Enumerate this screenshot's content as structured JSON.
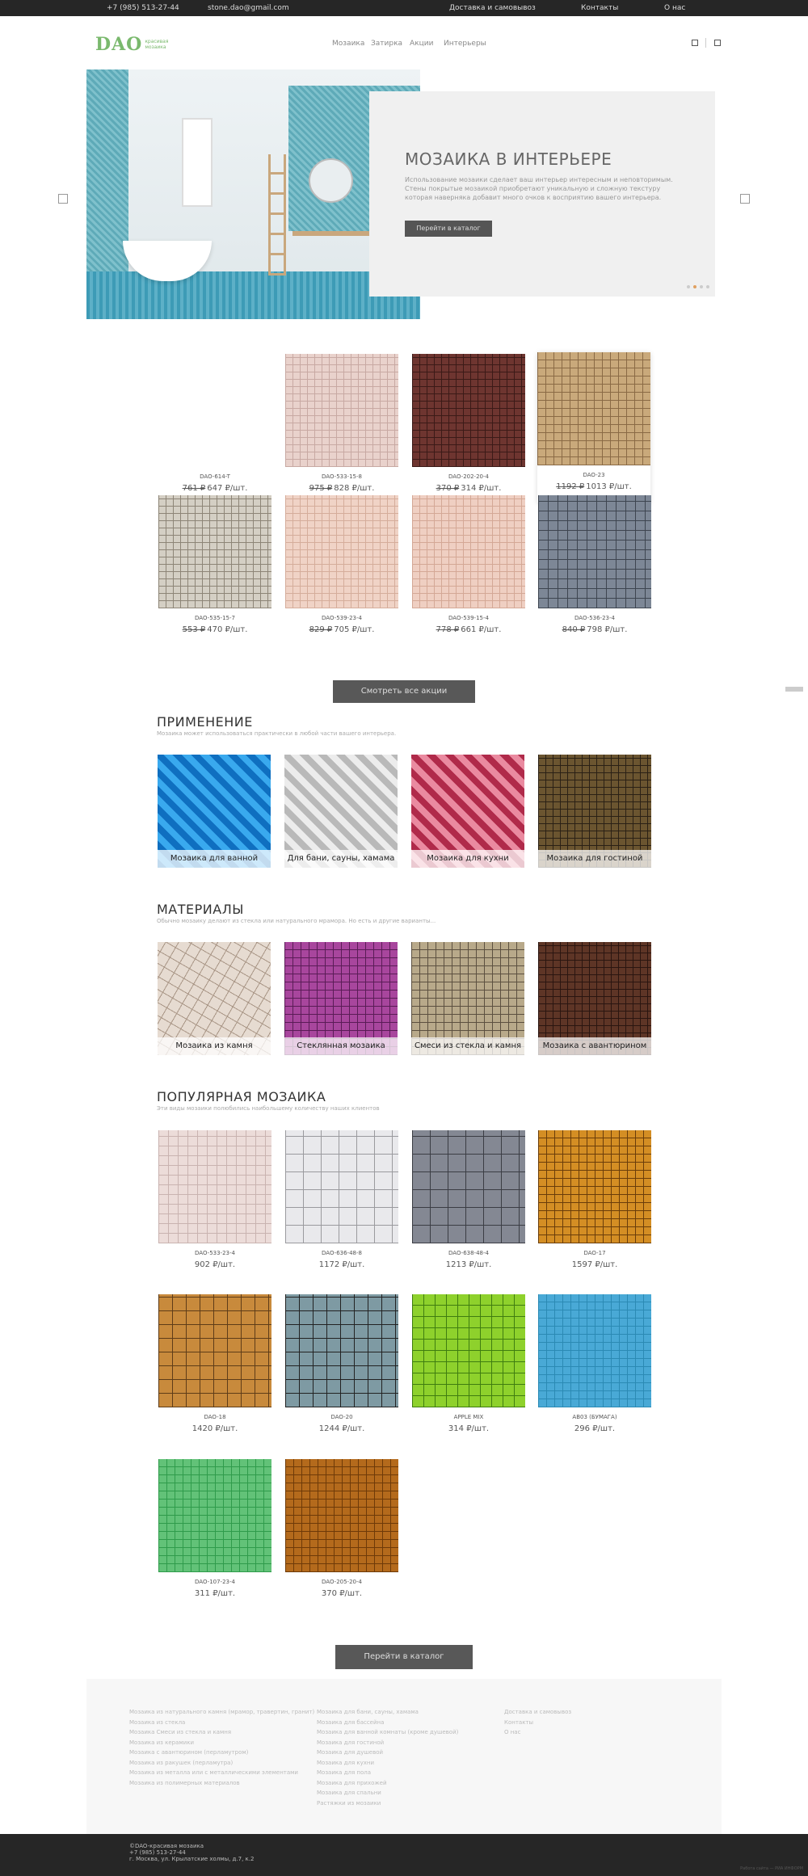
{
  "topbar": {
    "phone": "+7 (985) 513-27-44",
    "email": "stone.dao@gmail.com",
    "links": [
      "Доставка и самовывоз",
      "Контакты",
      "О нас"
    ]
  },
  "header": {
    "logo": "DAO",
    "logo_sub": "красивая мозаика",
    "nav": [
      "Мозаика",
      "Затирка",
      "Акции",
      "Интерьеры"
    ]
  },
  "hero": {
    "title": "МОЗАИКА В ИНТЕРЬЕРЕ",
    "text": "Использование мозаики сделает ваш интерьер интересным и неповторимым. Стены покрытые мозаикой приобретают уникальную и сложную текстуру которая наверняка добавит много очков к восприятию вашего интерьера.",
    "button": "Перейти в каталог"
  },
  "sale_products": [
    {
      "name": "DAO-614-T",
      "old": "761 ₽",
      "price": "647 ₽/шт."
    },
    {
      "name": "DAO-533-15-8",
      "old": "975 ₽",
      "price": "828 ₽/шт."
    },
    {
      "name": "DAO-202-20-4",
      "old": "370 ₽",
      "price": "314 ₽/шт."
    },
    {
      "name": "DAO-23",
      "old": "1192 ₽",
      "price": "1013 ₽/шт."
    },
    {
      "name": "DAO-535-15-7",
      "old": "553 ₽",
      "price": "470 ₽/шт."
    },
    {
      "name": "DAO-539-23-4",
      "old": "829 ₽",
      "price": "705 ₽/шт."
    },
    {
      "name": "DAO-539-15-4",
      "old": "778 ₽",
      "price": "661 ₽/шт."
    },
    {
      "name": "DAO-536-23-4",
      "old": "840 ₽",
      "price": "798 ₽/шт."
    }
  ],
  "sale_button": "Смотреть все акции",
  "application": {
    "title": "ПРИМЕНЕНИЕ",
    "subtitle": "Мозаика может использоваться практически в любой части вашего интерьера.",
    "items": [
      "Мозаика для ванной",
      "Для бани, сауны, хамама",
      "Мозаика для кухни",
      "Мозаика для гостиной"
    ]
  },
  "materials": {
    "title": "МАТЕРИАЛЫ",
    "subtitle": "Обычно мозаику делают из стекла или натурального мрамора. Но есть и другие варианты...",
    "items": [
      "Мозаика из камня",
      "Стеклянная мозаика",
      "Смеси из стекла и камня",
      "Мозаика с авантюрином"
    ]
  },
  "popular": {
    "title": "ПОПУЛЯРНАЯ МОЗАИКА",
    "subtitle": "Эти виды мозаики полюбились наибольшему количеству наших клиентов",
    "items": [
      {
        "name": "DAO-533-23-4",
        "price": "902 ₽/шт."
      },
      {
        "name": "DAO-636-48-8",
        "price": "1172 ₽/шт."
      },
      {
        "name": "DAO-638-48-4",
        "price": "1213 ₽/шт."
      },
      {
        "name": "DAO-17",
        "price": "1597 ₽/шт."
      },
      {
        "name": "DAO-18",
        "price": "1420 ₽/шт."
      },
      {
        "name": "DAO-20",
        "price": "1244 ₽/шт."
      },
      {
        "name": "APPLE MIX",
        "price": "314 ₽/шт."
      },
      {
        "name": "AB03 (БУМАГА)",
        "price": "296 ₽/шт."
      },
      {
        "name": "DAO-107-23-4",
        "price": "311 ₽/шт."
      },
      {
        "name": "DAO-205-20-4",
        "price": "370 ₽/шт."
      }
    ]
  },
  "catalog_button": "Перейти в каталог",
  "footer": {
    "col1": [
      "Мозаика из натурального камня (мрамор, травертин, гранит)",
      "Мозаика из стекла",
      "Мозаика Смеси из стекла и камня",
      "Мозаика из керамики",
      "Мозаика с авантюрином (перламутром)",
      "Мозаика из ракушек (перламутра)",
      "Мозаика из металла или с металлическими элементами",
      "Мозаика из полимерных материалов"
    ],
    "col2": [
      "Мозаика для бани, сауны, хамама",
      "Мозаика для бассейна",
      "Мозаика для ванной комнаты (кроме душевой)",
      "Мозаика для гостиной",
      "Мозаика для душевой",
      "Мозаика для кухни",
      "Мозаика для пола",
      "Мозаика для прихожей",
      "Мозаика для спальни",
      "Растяжки из мозаики"
    ],
    "col3": [
      "Доставка и самовывоз",
      "Контакты",
      "О нас"
    ],
    "bottom": [
      "©DAO-красивая мозаика",
      "+7 (985) 513-27-44",
      "г. Москва, ул. Крылатские холмы, д.7, к.2"
    ],
    "credit": "Работа сайта — РИА ИНФОРМ"
  },
  "colors": {
    "accent": "#7ab96d",
    "dark": "#262626",
    "button": "#585858",
    "dot_active": "#e0a060"
  }
}
